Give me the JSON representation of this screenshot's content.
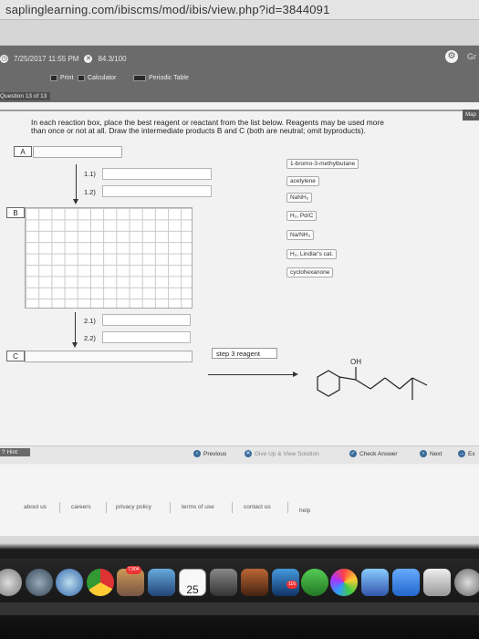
{
  "browser": {
    "url": "saplinglearning.com/ibiscms/mod/ibis/view.php?id=3844091"
  },
  "header": {
    "datetime": "7/25/2017 11:55 PM",
    "score": "84.3/100",
    "gr_label": "Gr",
    "tools": {
      "print": "Print",
      "calculator": "Calculator",
      "periodic_table": "Periodic Table"
    },
    "question_number": "Question 13 of 13",
    "map_tab": "Map"
  },
  "question": {
    "instructions_line1": "In each reaction box, place the best reagent or reactant from the list below. Reagents may be used more",
    "instructions_line2": "than once or not at all. Draw the intermediate products B and C (both are neutral; omit byproducts).",
    "box_a": "A",
    "box_b": "B",
    "box_c": "C",
    "step_1_1": "1.1)",
    "step_1_2": "1.2)",
    "step_2_1": "2.1)",
    "step_2_2": "2.2)",
    "step3_reagent": "step 3 reagent",
    "product_oh": "OH"
  },
  "reagents": [
    "1-bromo-3-methylbutane",
    "acetylene",
    "NaNH₂",
    "H₂, Pd/C",
    "Na/NH₃",
    "H₂, Lindlar's cat.",
    "cyclohexanone"
  ],
  "nav": {
    "hint": "Hint",
    "previous": "Previous",
    "give_up": "Give Up & View Solution",
    "check_answer": "Check Answer",
    "next": "Next",
    "exit": "Ex"
  },
  "footer": {
    "links": [
      "about us",
      "careers",
      "privacy policy",
      "terms of use",
      "contact us",
      "help"
    ]
  },
  "dock": {
    "calendar_day": "25",
    "calendar_month": "JUL",
    "badge_photos": "7,904",
    "badge_mail": "116"
  }
}
